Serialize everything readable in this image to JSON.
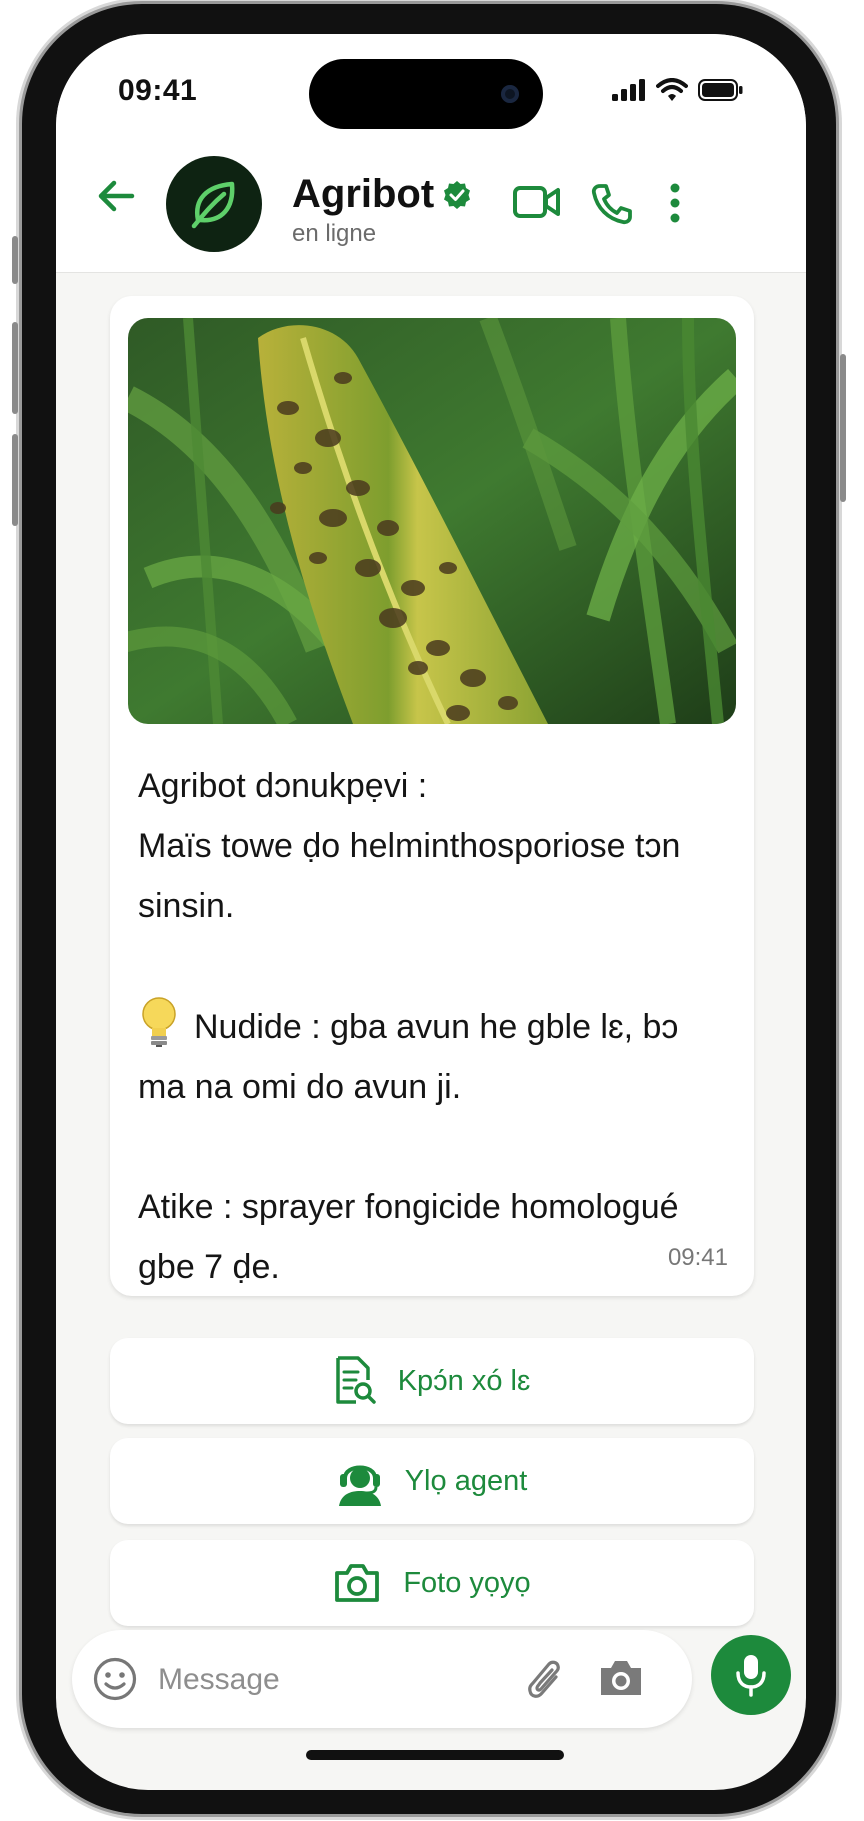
{
  "status_bar": {
    "time": "09:41"
  },
  "header": {
    "contact_name": "Agribot",
    "presence": "en ligne",
    "icons": [
      "back-arrow-icon",
      "leaf-icon",
      "verified-badge-icon",
      "video-call-icon",
      "phone-icon",
      "more-vert-icon"
    ]
  },
  "message": {
    "title": "Agribot dɔnukpẹvi :",
    "diagnosis": "Maïs towe ḍo helminthosporiose tɔn sinsin.",
    "tip": "Nudide : gba avun he gble lɛ, bɔ ma na omi do avun ji.",
    "action": "Atike : sprayer fongicide homologué gbe 7 ḍe.",
    "time": "09:41",
    "image_subject": "maize-leaf-with-spots"
  },
  "quick_actions": [
    {
      "label": "Kpɔ́n xó lɛ",
      "icon": "document-search-icon"
    },
    {
      "label": "Ylọ agent",
      "icon": "headset-agent-icon"
    },
    {
      "label": "Foto yọyọ",
      "icon": "camera-icon"
    }
  ],
  "composer": {
    "placeholder": "Message",
    "icons": [
      "emoji-icon",
      "paperclip-icon",
      "camera-icon",
      "microphone-icon"
    ]
  },
  "colors": {
    "accent": "#1d8a3c",
    "background": "#f6f6f4",
    "bubble": "#ffffff"
  }
}
